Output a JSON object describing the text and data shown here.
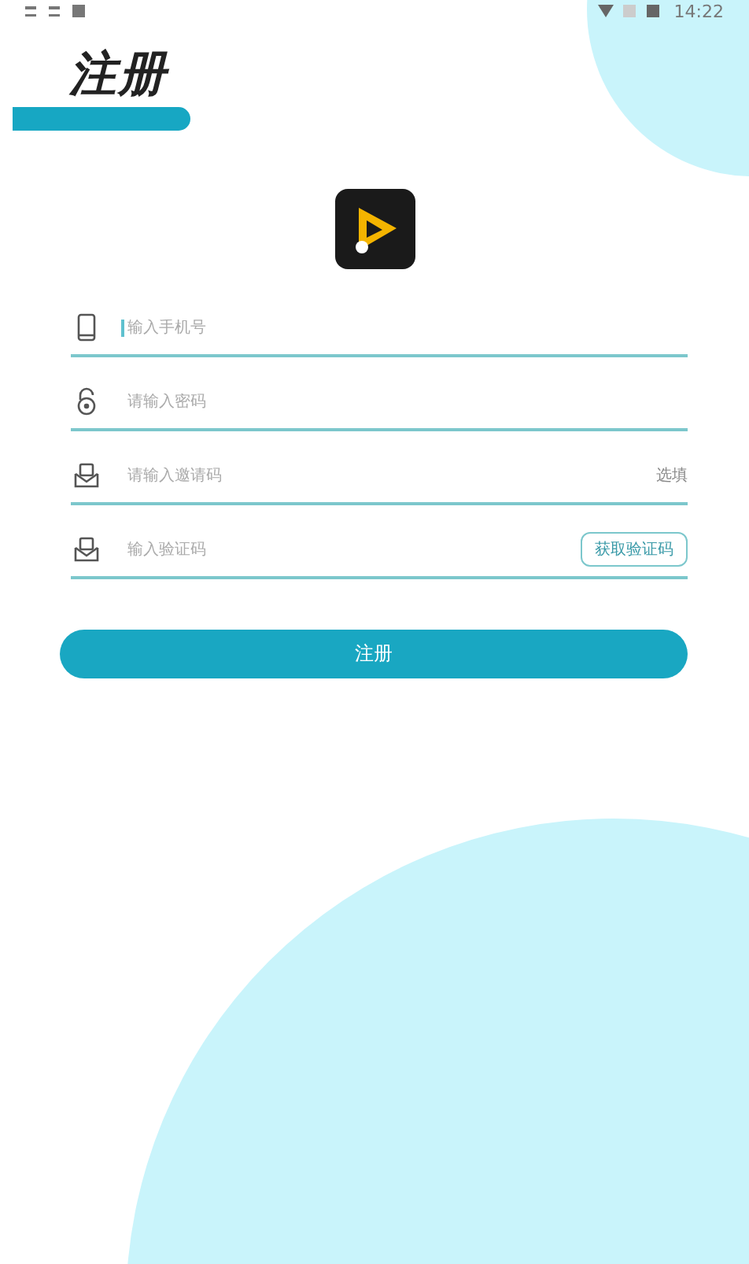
{
  "status_bar": {
    "time": "14:22"
  },
  "title": "注册",
  "fields": [
    {
      "kind": "phone",
      "placeholder": "输入手机号",
      "focused": true
    },
    {
      "kind": "password",
      "placeholder": "请输入密码",
      "focused": false
    },
    {
      "kind": "invite",
      "placeholder": "请输入邀请码",
      "focused": false,
      "hint": "选填"
    },
    {
      "kind": "code",
      "placeholder": "输入验证码",
      "focused": false,
      "action": "获取验证码"
    }
  ],
  "submit": "注册"
}
